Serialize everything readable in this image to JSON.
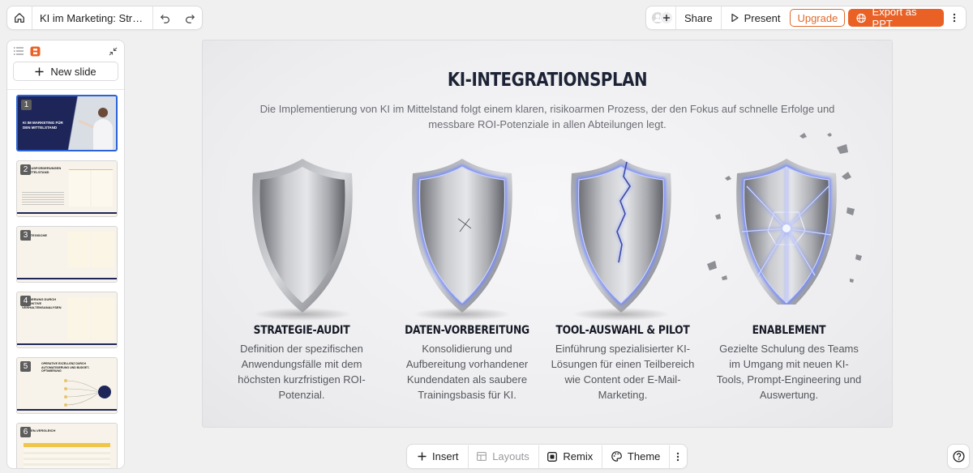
{
  "topbar": {
    "doc_title": "KI im Marketing: Strate…",
    "share_label": "Share",
    "present_label": "Present",
    "upgrade_label": "Upgrade",
    "export_label": "Export as PPT"
  },
  "sidebar": {
    "new_slide_label": "New slide",
    "thumbnails": [
      {
        "num": "1",
        "title": "KI IM MARKETING FÜR DEN MITTELSTAND"
      },
      {
        "num": "2",
        "title": "HERAUSFORDERUNGEN IM MITTELSTAND"
      },
      {
        "num": "3",
        "title": "STRATEGISCHE ZIELE"
      },
      {
        "num": "4",
        "title": "STEIGERUNG DURCH PRÄDIKTIVE VERHALTENSANALYSEN"
      },
      {
        "num": "5",
        "title": "OPERATIVE EXZELLENZ DURCH AUTOMATISIERUNG UND BUDGET-OPTIMIERUNG"
      },
      {
        "num": "6",
        "title": "KOSTEN-VERGLEICH"
      }
    ]
  },
  "slide": {
    "title": "KI-INTEGRATIONSPLAN",
    "subtitle": "Die Implementierung von KI im Mittelstand folgt einem klaren, risikoarmen Prozess, der den Fokus auf schnelle Erfolge und messbare ROI-Potenziale in allen Abteilungen legt.",
    "steps": [
      {
        "heading": "STRATEGIE-AUDIT",
        "text": "Definition der spezifischen Anwendungsfälle mit dem höchsten kurzfristigen ROI-Potenzial."
      },
      {
        "heading": "DATEN-VORBEREITUNG",
        "text": "Konsolidierung und Aufbereitung vorhandener Kundendaten als saubere Trainingsbasis für KI."
      },
      {
        "heading": "TOOL-AUSWAHL & PILOT",
        "text": "Einführung spezialisierter KI-Lösungen für einen Teilbereich wie Content oder E-Mail-Marketing."
      },
      {
        "heading": "ENABLEMENT",
        "text": "Gezielte Schulung des Teams im Umgang mit neuen KI-Tools, Prompt-Engineering und Auswertung."
      }
    ]
  },
  "bottombar": {
    "insert_label": "Insert",
    "layouts_label": "Layouts",
    "remix_label": "Remix",
    "theme_label": "Theme"
  },
  "colors": {
    "accent": "#ea6125",
    "title": "#1d2336",
    "glow": "#6f86ff"
  }
}
